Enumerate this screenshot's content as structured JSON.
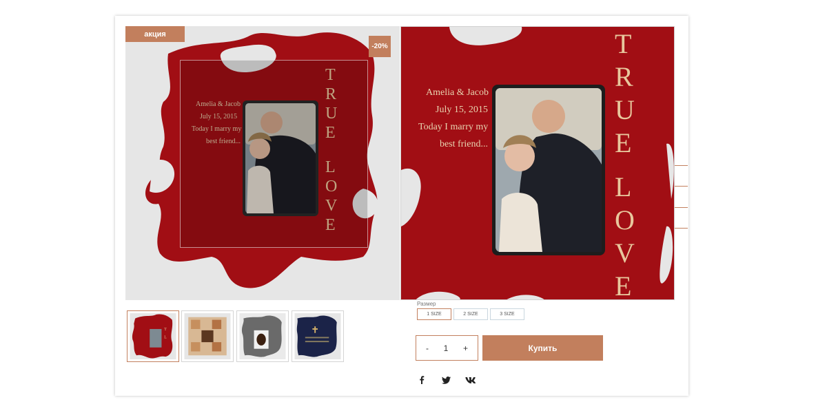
{
  "product": {
    "badge_sale": "акция",
    "badge_discount": "-20%",
    "title_partial": "e",
    "frame_text": {
      "line1": "Amelia & Jacob",
      "line2": "July 15, 2015",
      "line3": "Today I marry my",
      "line4": "best friend...",
      "vertical": [
        "T",
        "R",
        "U",
        "E",
        "L",
        "O",
        "V",
        "E"
      ]
    }
  },
  "thumbnails": [
    {
      "name": "red-true-love",
      "color": "#a10e14",
      "active": true
    },
    {
      "name": "beige-alphabet",
      "color": "#c8a27e",
      "active": false
    },
    {
      "name": "grey-dog",
      "color": "#6a6a6a",
      "active": false
    },
    {
      "name": "navy-cross",
      "color": "#1b2348",
      "active": false
    }
  ],
  "size": {
    "label": "Размер",
    "options": [
      "1 SIZE",
      "2 SIZE",
      "3 SIZE"
    ],
    "selected": "1 SIZE"
  },
  "quantity": {
    "minus": "-",
    "value": "1",
    "plus": "+"
  },
  "buy_label": "Купить",
  "social": {
    "facebook": "f",
    "twitter": "t",
    "vk": "vk"
  },
  "colors": {
    "accent": "#c27f5d",
    "frame_red": "#a10e14"
  }
}
